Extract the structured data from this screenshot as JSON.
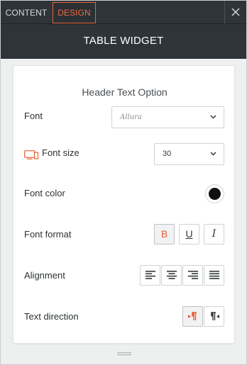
{
  "tabs": {
    "content": "CONTENT",
    "design": "DESIGN"
  },
  "title": "TABLE WIDGET",
  "section_title": "Header Text Option",
  "rows": {
    "font": {
      "label": "Font",
      "value": "Allura"
    },
    "font_size": {
      "label": "Font size",
      "value": "30"
    },
    "font_color": {
      "label": "Font color",
      "color": "#111111"
    },
    "font_format": {
      "label": "Font format",
      "bold": "B",
      "underline": "U",
      "italic": "I"
    },
    "alignment": {
      "label": "Alignment"
    },
    "text_direction": {
      "label": "Text direction"
    }
  },
  "colors": {
    "accent": "#ea5a2d",
    "topbar": "#2e3438"
  },
  "icons": [
    "close-icon",
    "chevron-down-icon",
    "responsive-devices-icon",
    "align-left-icon",
    "align-center-icon",
    "align-right-icon",
    "align-justify-icon",
    "ltr-direction-icon",
    "rtl-direction-icon",
    "resize-grip-icon"
  ]
}
